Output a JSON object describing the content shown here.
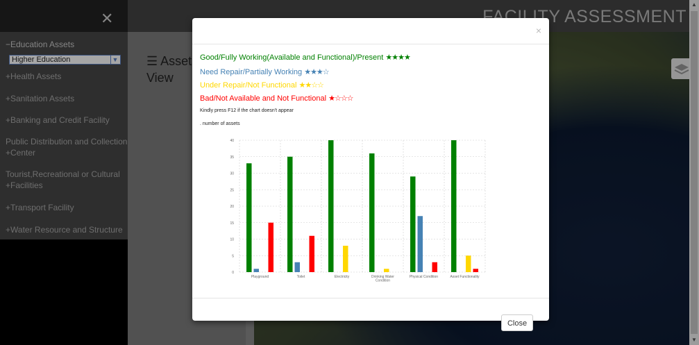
{
  "header": {
    "title": "FACILITY ASSESSMENT"
  },
  "sidebar": {
    "close_icon": "close-icon",
    "items": [
      {
        "label": "−Education Assets"
      },
      {
        "label": "+Health Assets"
      },
      {
        "label": "+Sanitation Assets"
      },
      {
        "label": "+Banking and Credit Facility"
      },
      {
        "label": "Public Distribution and Collection",
        "label2": "+Center"
      },
      {
        "label": "Tourist,Recreational or Cultural",
        "label2": "+Facilities"
      },
      {
        "label": "+Transport Facility"
      },
      {
        "label": "+Water Resource and Structure"
      }
    ],
    "education_select": {
      "value": "Higher Education"
    }
  },
  "main": {
    "heading_line1": "☰ Assets",
    "heading_line2": "View"
  },
  "modal": {
    "close_symbol": "×",
    "legend": [
      {
        "text": "Good/Fully Working(Available and Functional)/Present",
        "stars": "★★★★",
        "color": "#008000"
      },
      {
        "text": "Need Repair/Partially Working",
        "stars": "★★★☆",
        "color": "#4682b4"
      },
      {
        "text": "Under Repair/Not Functional",
        "stars": "★★☆☆",
        "color": "#ffd700"
      },
      {
        "text": "Bad/Not Available and Not Functional",
        "stars": "★☆☆☆",
        "color": "#ff0000"
      }
    ],
    "note": "Kindly press F12 if the chart doesn't appear",
    "subnote": ". number of assets",
    "close_button": "Close"
  },
  "chart_data": {
    "type": "bar",
    "categories": [
      "Playground",
      "Toilet",
      "Electricity",
      "Drinking Water Condition",
      "Physical Condition",
      "Asset Functionality"
    ],
    "ylim": [
      0,
      40
    ],
    "yticks": [
      0,
      5,
      10,
      15,
      20,
      25,
      30,
      35,
      40
    ],
    "series": [
      {
        "color": "#008000",
        "values": [
          33,
          35,
          40,
          36,
          29,
          40
        ]
      },
      {
        "color": "#4682b4",
        "values": [
          1,
          3,
          0,
          0,
          17,
          0
        ]
      },
      {
        "color": "#ffd700",
        "values": [
          0,
          0,
          8,
          1,
          0,
          5
        ]
      },
      {
        "color": "#ff0000",
        "values": [
          15,
          11,
          0,
          0,
          3,
          1
        ]
      }
    ],
    "grid": true
  }
}
